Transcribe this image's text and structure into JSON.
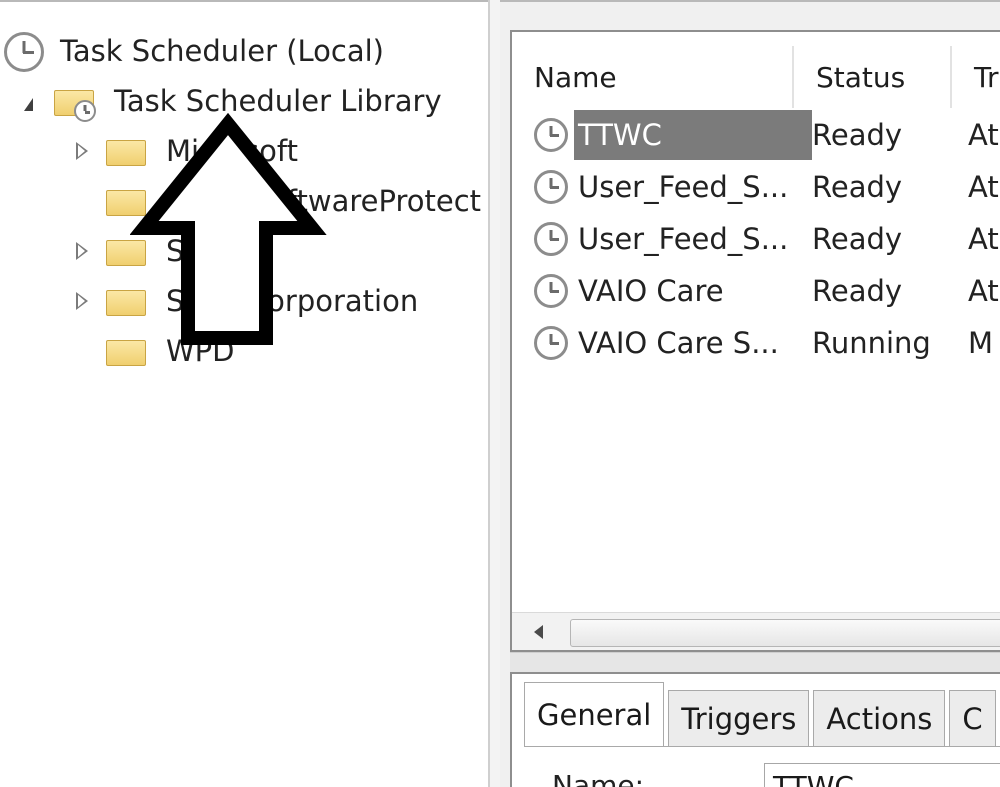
{
  "tree": {
    "root": "Task Scheduler (Local)",
    "library": "Task Scheduler Library",
    "folders": [
      {
        "label": "Microsoft",
        "expandable": true
      },
      {
        "label": "OfficeSoftwareProtect",
        "expandable": false
      },
      {
        "label": "Sony",
        "expandable": true
      },
      {
        "label": "Sony Corporation",
        "expandable": true
      },
      {
        "label": "WPD",
        "expandable": false
      }
    ]
  },
  "task_list": {
    "columns": [
      "Name",
      "Status",
      "Tr"
    ],
    "rows": [
      {
        "name": "TTWC",
        "status": "Ready",
        "triggers": "At",
        "selected": true
      },
      {
        "name": "User_Feed_S...",
        "status": "Ready",
        "triggers": "At"
      },
      {
        "name": "User_Feed_S...",
        "status": "Ready",
        "triggers": "At"
      },
      {
        "name": "VAIO Care",
        "status": "Ready",
        "triggers": "At"
      },
      {
        "name": "VAIO Care S...",
        "status": "Running",
        "triggers": "M"
      }
    ]
  },
  "details": {
    "tabs": [
      "General",
      "Triggers",
      "Actions",
      "C"
    ],
    "active_tab": "General",
    "name_label": "Name:",
    "name_value": "TTWC"
  },
  "colors": {
    "selection": "#7b7b7b",
    "folder": "#f0cf6f",
    "arrow": "#000000"
  }
}
